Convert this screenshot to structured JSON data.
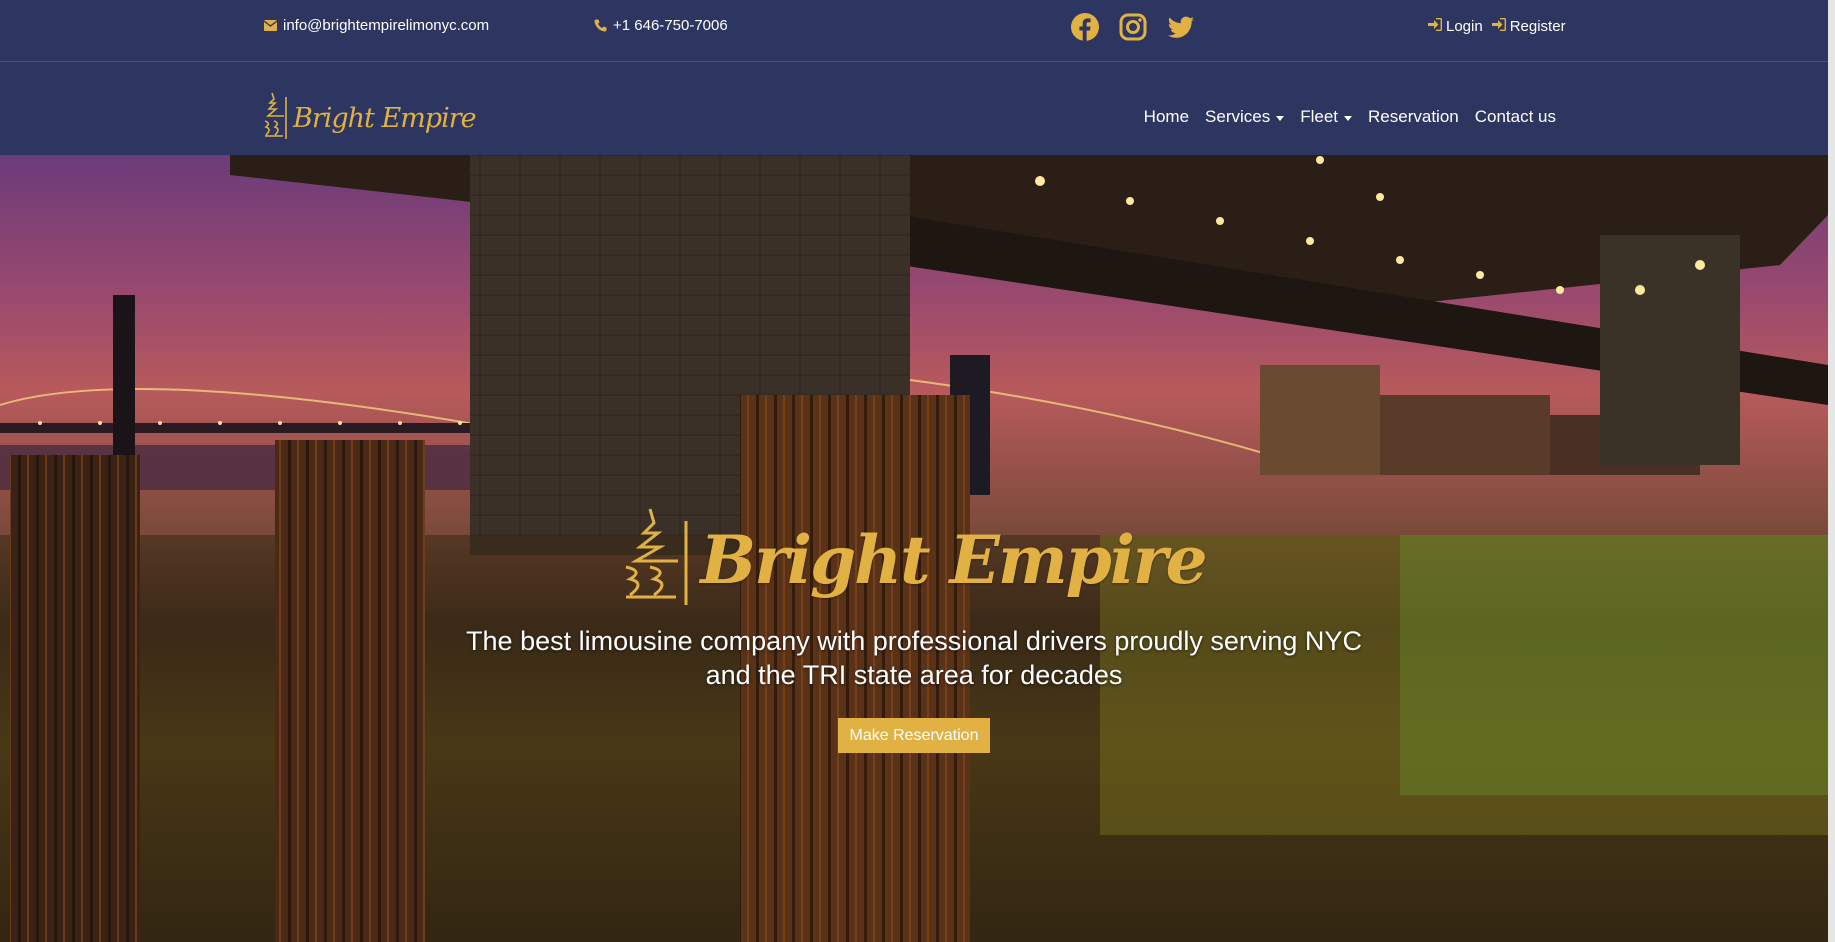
{
  "topbar": {
    "email": "info@brightempirelimonyc.com",
    "phone": "+1 646-750-7006",
    "social": [
      "facebook-icon",
      "instagram-icon",
      "twitter-icon"
    ],
    "login": "Login",
    "register": "Register"
  },
  "navbar": {
    "brand": "Bright Empire",
    "links": {
      "home": "Home",
      "services": "Services",
      "fleet": "Fleet",
      "reservation": "Reservation",
      "contact": "Contact us"
    }
  },
  "hero": {
    "brand": "Bright Empire",
    "tagline": "The best limousine company with professional drivers proudly serving NYC and the TRI state area for decades",
    "cta": "Make Reservation"
  },
  "colors": {
    "navy": "#2d3561",
    "gold": "#e1b243"
  }
}
